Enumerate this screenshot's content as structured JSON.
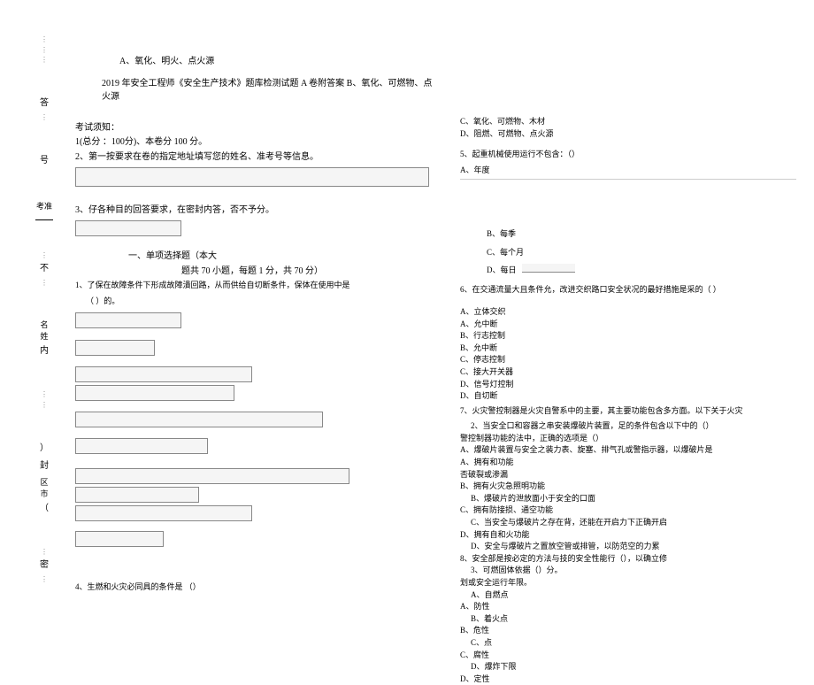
{
  "margin": {
    "answer": "答",
    "exam_id": "考准",
    "number": "号",
    "not": "不",
    "name": "名姓",
    "inside": "内",
    "paren_close": "）",
    "seal": "封",
    "area_city": "区市",
    "paren_open": "（",
    "secret": "密",
    "dots": "⋮"
  },
  "header": {
    "option_a": "A、氧化、明火、点火源",
    "title": "2019 年安全工程师《安全生产技术》题库检测试题 A 卷附答案 B、氧化、可燃物、点火源"
  },
  "notice": {
    "title": "考试须知：",
    "line1": "1(总分 ：100分)、本卷分 100 分。",
    "line2": "2、第一按要求在卷的指定地址填写您的姓名、准考号等信息。",
    "line3": "3、仔各种目的回答要求，在密封内答，否不予分。"
  },
  "section1": {
    "title": "一、单项选择题（本大",
    "title2": "题共         70 小题，每题 1 分，共 70 分）"
  },
  "q1": {
    "text": "1、了保在故障条件下形成故障潰回路，从而供给自切断条件，保体在使用中是",
    "text2": "（     ）的。"
  },
  "q4": {
    "text": "4、生燃和火灾必同具的条件是 （）"
  },
  "right_options_top": {
    "c": "C、氧化、可燃物、木材",
    "d": "D、阻燃、可燃物、点火源"
  },
  "q5": {
    "text": "5、起重机械使用运行不包含：（）",
    "a": "A、年度",
    "b": "B、每季",
    "c": "C、每个月",
    "d": "D、每日"
  },
  "q6": {
    "text": "6、在交通流量大且条件允，改进交织路口安全状况的最好措施是采的（               ）",
    "a": "A、立体交织",
    "a2": "A、允中断",
    "b": "B、行志控制",
    "b2": "B、允中断",
    "c": "C、停志控制",
    "c2": "C、接大开关器",
    "d": "D、信号灯控制",
    "d2": "D、自切断"
  },
  "q7": {
    "text": "7、火灾警控制器是火灾自警系中的主要，其主要功能包含多方面。以下关于火灾",
    "text_sub": "2、当安全口和容器之串安装爆破片装置，足的条件包含以下中的（）",
    "text2": "警控制器功能的法中，正确的选项是（）",
    "a": "A、爆破片装置与安全之装力表、旋塞、排气孔或警指示器，以爆破片是",
    "a2": "A、拥有和功能",
    "a3": "否破裂或渗漏",
    "b": "B、拥有火灾急照明功能",
    "b2": "B、爆破片的泄放面小于安全的口面",
    "c": "C、拥有防接损、通空功能",
    "c2": "C、当安全与爆破片之存在背，还能在开启力下正确开启",
    "d": "D、拥有自和火功能",
    "d2": "D、安全与爆破片之置放空管或排管，以防范空的力累",
    "line8": "8、安全部是按必定的方法与技的安全性能行（），以确立修",
    "q3": "3、可燃固体依据（）分。",
    "line_burn": "划或安全运行年限。",
    "a_burn": "A、自燃点",
    "a_prop": "A、防性",
    "b_burn": "B、着火点",
    "b_prop": "B、危性",
    "c_burn": "C、点",
    "c_prop": "C、腐性",
    "d_burn": "D、爆炸下限",
    "d_prop": "D、定性"
  }
}
